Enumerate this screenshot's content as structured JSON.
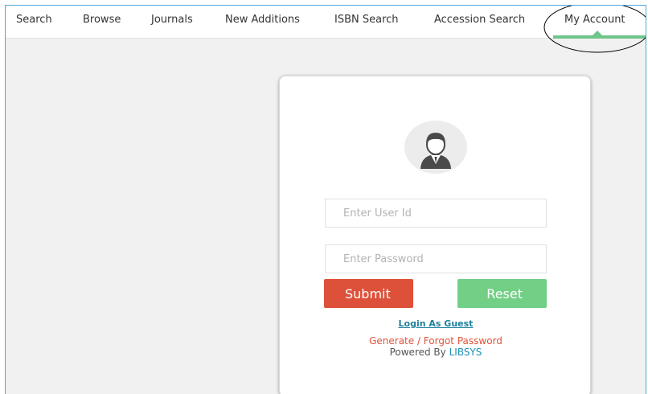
{
  "nav": {
    "items": [
      {
        "label": "Search"
      },
      {
        "label": "Browse"
      },
      {
        "label": "Journals"
      },
      {
        "label": "New Additions"
      },
      {
        "label": "ISBN Search"
      },
      {
        "label": "Accession Search"
      },
      {
        "label": "My Account",
        "active": true
      }
    ],
    "active_color": "#6dc68a"
  },
  "login": {
    "avatar_icon": "user-avatar-icon",
    "user_id_placeholder": "Enter User Id",
    "password_placeholder": "Enter Password",
    "submit_label": "Submit",
    "reset_label": "Reset",
    "guest_link": "Login As Guest",
    "forgot_link": "Generate / Forgot Password",
    "powered_prefix": "Powered By",
    "powered_brand": "LIBSYS"
  },
  "colors": {
    "submit": "#dd513a",
    "reset": "#72cf86",
    "link": "#1d7f9e",
    "forgot": "#e05238",
    "frame_border": "#4aa8d8"
  }
}
